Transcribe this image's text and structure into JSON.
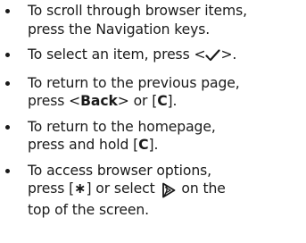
{
  "items": [
    {
      "line1": "To scroll through browser items,",
      "line2": "press the Navigation keys."
    },
    {
      "prefix": "To select an item, press <",
      "icon": "checkmark-softkey-icon",
      "suffix": ">."
    },
    {
      "line1": "To return to the previous page,",
      "pre_back": "press <",
      "back_key": "Back",
      "mid": "> or [",
      "c_key": "C",
      "end": "]."
    },
    {
      "line1": "To return to the homepage,",
      "pre_c": "press and hold [",
      "c_key": "C",
      "end": "]."
    },
    {
      "line1": "To access browser options,",
      "pre_star": "press [",
      "star_key": "∗",
      "mid": "] or select",
      "icon": "browser-options-icon",
      "post_icon": "on the",
      "line3": "top of the screen."
    }
  ]
}
